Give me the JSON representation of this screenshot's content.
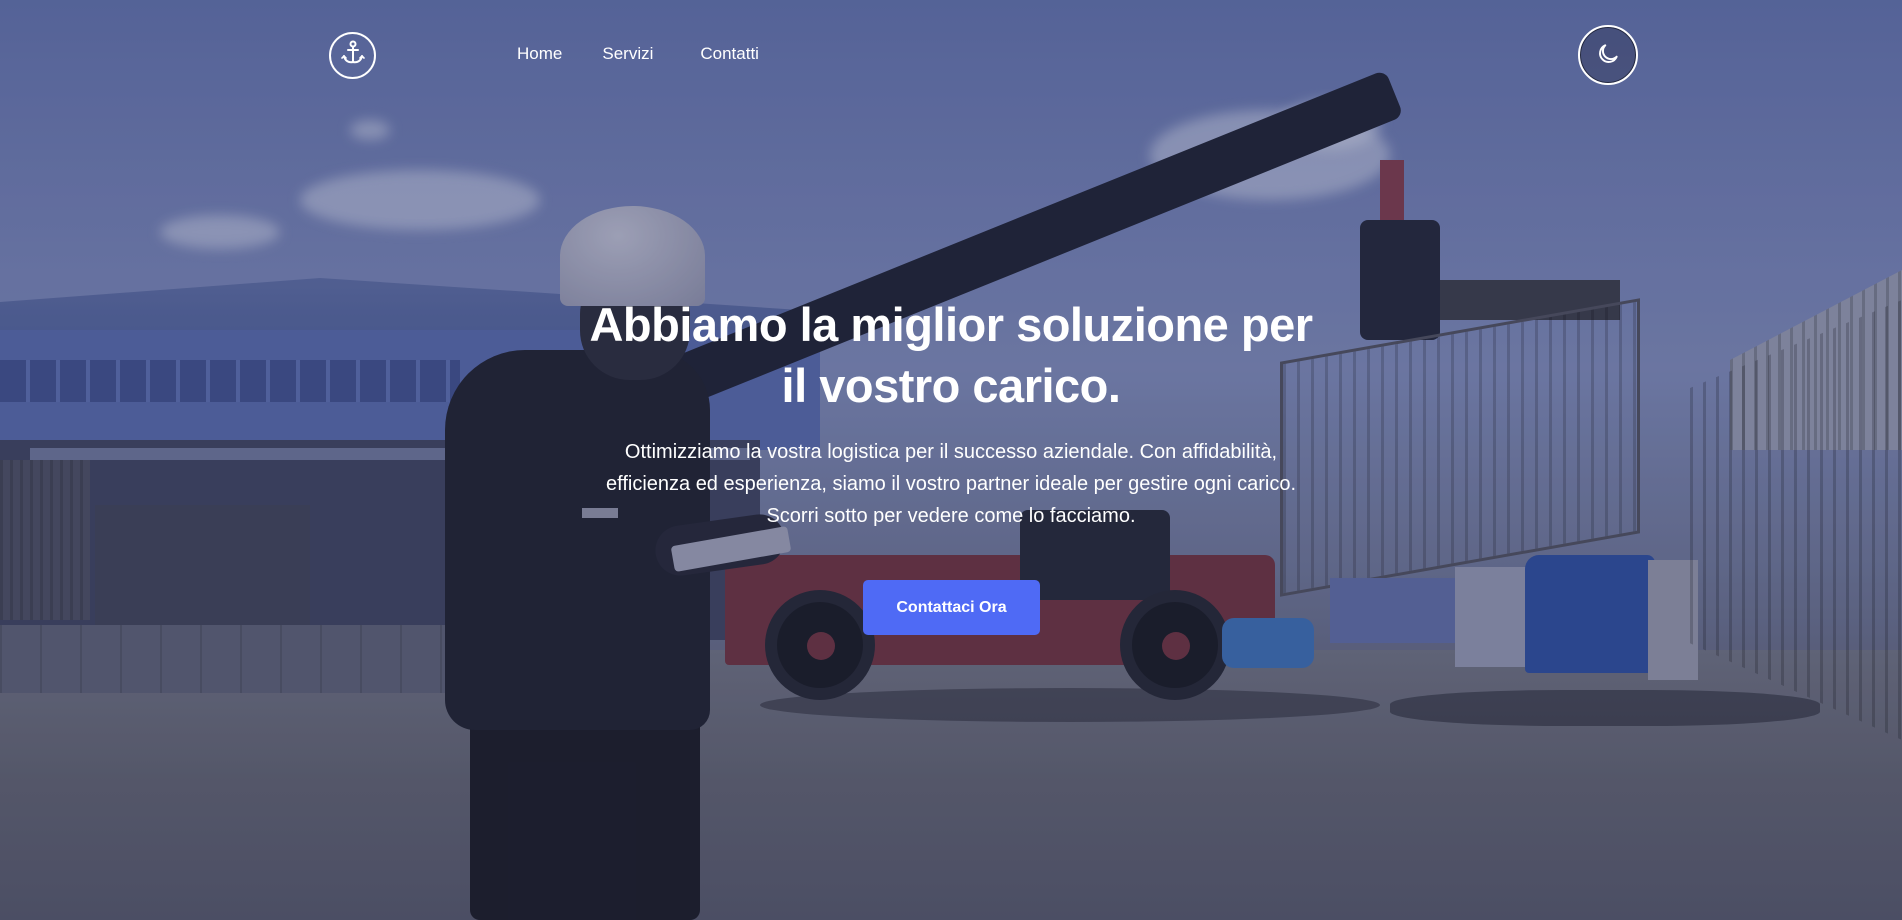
{
  "header": {
    "logo_icon": "anchor-icon",
    "nav": {
      "home": "Home",
      "services": "Servizi",
      "contacts": "Contatti"
    },
    "theme_toggle_icon": "moon-icon"
  },
  "hero": {
    "title_line1": "Abbiamo la miglior soluzione per",
    "title_line2": "il vostro carico.",
    "subtitle_line1": "Ottimizziamo la vostra logistica per il successo aziendale. Con affidabilità,",
    "subtitle_line2": "efficienza ed esperienza, siamo il vostro partner ideale per gestire ogni carico.",
    "subtitle_line3": "Scorri sotto per vedere come lo facciamo.",
    "cta_label": "Contattaci Ora"
  },
  "colors": {
    "cta": "#4f6af5",
    "overlay": "#262a4e"
  }
}
